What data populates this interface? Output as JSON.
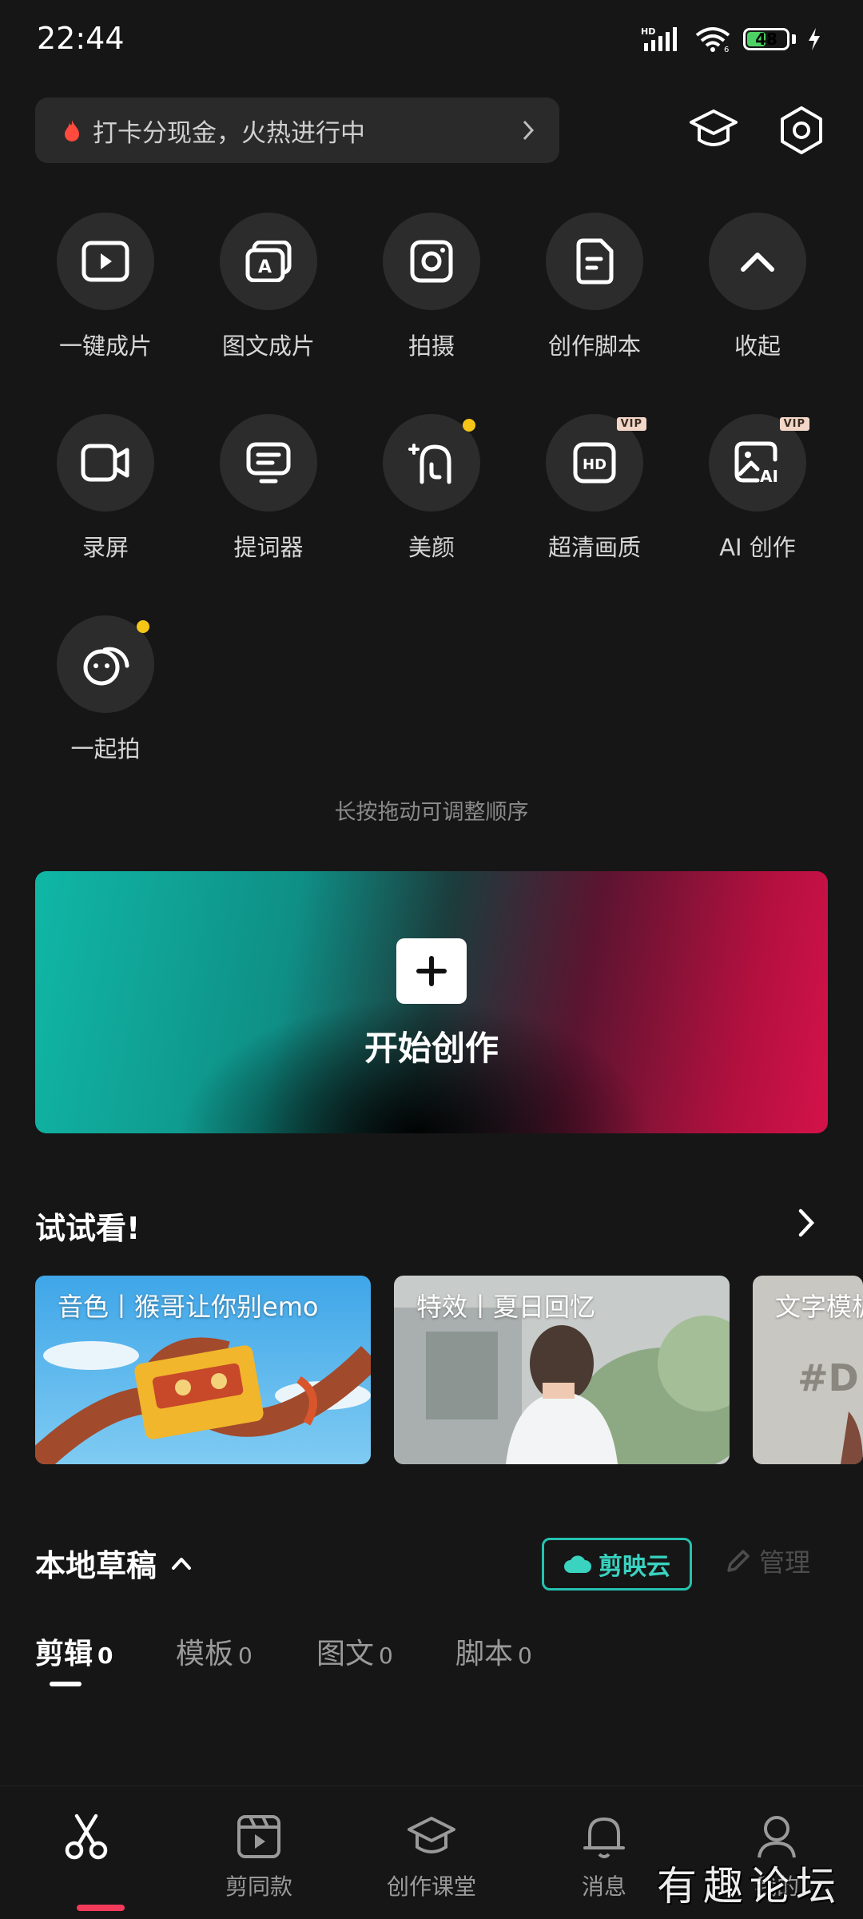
{
  "status_bar": {
    "time": "22:44",
    "battery": "48",
    "battery_level": 0.48
  },
  "promo": {
    "text": "打卡分现金，火热进行中"
  },
  "quick_actions": [
    {
      "label": "一键成片"
    },
    {
      "label": "图文成片"
    },
    {
      "label": "拍摄"
    },
    {
      "label": "创作脚本"
    },
    {
      "label": "收起"
    },
    {
      "label": "录屏"
    },
    {
      "label": "提词器"
    },
    {
      "label": "美颜"
    },
    {
      "label": "超清画质",
      "badge": "VIP"
    },
    {
      "label": "AI 创作",
      "badge": "VIP"
    },
    {
      "label": "一起拍"
    }
  ],
  "reorder_hint": "长按拖动可调整顺序",
  "create": {
    "label": "开始创作"
  },
  "try_section": {
    "title": "试试看!",
    "cards": [
      {
        "title": "音色丨猴哥让你别emo"
      },
      {
        "title": "特效丨夏日回忆"
      },
      {
        "title": "文字模板"
      }
    ]
  },
  "drafts": {
    "title": "本地草稿",
    "cloud_label": "剪映云",
    "manage_label": "管理",
    "tabs": [
      {
        "label": "剪辑",
        "count": "0"
      },
      {
        "label": "模板",
        "count": "0"
      },
      {
        "label": "图文",
        "count": "0"
      },
      {
        "label": "脚本",
        "count": "0"
      }
    ]
  },
  "bottom_nav": [
    {
      "label": ""
    },
    {
      "label": "剪同款"
    },
    {
      "label": "创作课堂"
    },
    {
      "label": "消息"
    },
    {
      "label": "我的"
    }
  ],
  "watermark": "有趣论坛",
  "colors": {
    "accent": "#25c2b0",
    "active_tab_bar": "#f23b5b",
    "dot": "#f5c518"
  }
}
